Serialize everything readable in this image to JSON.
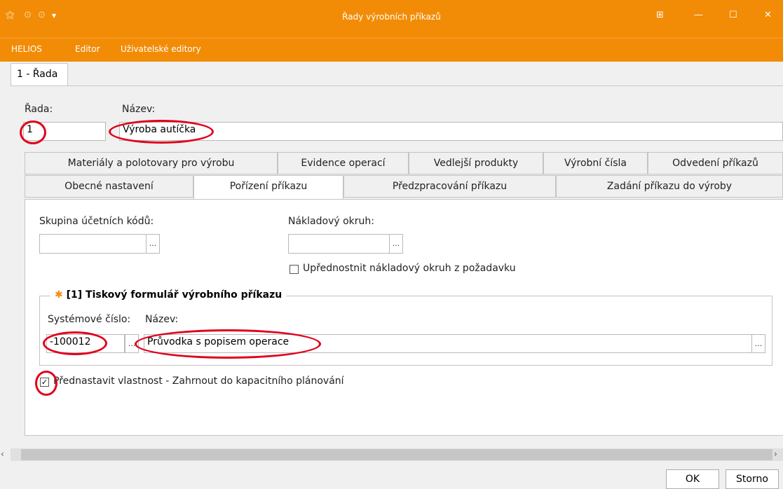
{
  "window": {
    "title": "Řady výrobních příkazů"
  },
  "menu": {
    "items": [
      "HELIOS",
      "Editor",
      "Uživatelské editory"
    ]
  },
  "form": {
    "tab_label": "1 - Řada",
    "rada_label": "Řada:",
    "rada_value": "1",
    "nazev_label": "Název:",
    "nazev_value": "Výroba autíčka"
  },
  "tabs": {
    "row1": [
      "Materiály a polotovary pro výrobu",
      "Evidence operací",
      "Vedlejší produkty",
      "Výrobní čísla",
      "Odvedení příkazů"
    ],
    "row2": [
      "Obecné nastavení",
      "Pořízení příkazu",
      "Předzpracování příkazu",
      "Zadání příkazu do výroby"
    ],
    "active": "Pořízení příkazu"
  },
  "panel": {
    "skupina_label": "Skupina účetních kódů:",
    "skupina_value": "",
    "naklad_label": "Nákladový okruh:",
    "naklad_value": "",
    "uprednostnit_label": "Upřednostnit nákladový okruh z požadavku",
    "uprednostnit_checked": false,
    "group_title": "[1] Tiskový formulář výrobního příkazu",
    "syscislo_label": "Systémové číslo:",
    "syscislo_value": "-100012",
    "nazev2_label": "Název:",
    "nazev2_value": "Průvodka s popisem operace",
    "prednastavit_label": "Přednastavit vlastnost - Zahrnout do kapacitního plánování",
    "prednastavit_checked": true
  },
  "buttons": {
    "ok": "OK",
    "storno": "Storno"
  },
  "icons": {
    "ellipsis": "...",
    "check": "✓"
  },
  "colors": {
    "titlebar": "#f28c06",
    "annotation": "#e0001b"
  }
}
